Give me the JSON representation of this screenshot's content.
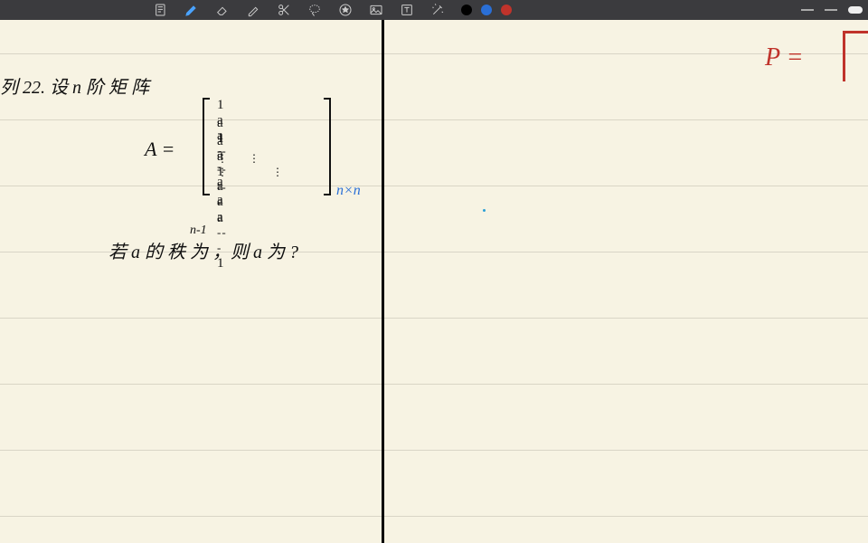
{
  "toolbar": {
    "icons": [
      {
        "name": "page-icon"
      },
      {
        "name": "pen-icon",
        "active": true
      },
      {
        "name": "eraser-icon"
      },
      {
        "name": "highlighter-icon"
      },
      {
        "name": "cut-icon"
      },
      {
        "name": "lasso-icon"
      },
      {
        "name": "star-tool-icon"
      },
      {
        "name": "image-icon"
      },
      {
        "name": "text-tool-icon"
      },
      {
        "name": "wand-icon"
      }
    ],
    "colors": [
      {
        "name": "color-black",
        "hex": "#000000"
      },
      {
        "name": "color-blue",
        "hex": "#2a6fd6"
      },
      {
        "name": "color-red",
        "hex": "#c0332b"
      }
    ]
  },
  "notes": {
    "left": {
      "line1": "列 22.  设 n 阶 矩 阵",
      "A_eq": "A =",
      "matrix_rows": [
        "1  a  a  ---  a",
        "a  1  a  ---  a",
        "a  a  1  ---  a",
        "⋮   ⋮   ⋮        ⋮",
        "a  a  a  ---  1"
      ],
      "matrix_sub": "n×n",
      "exponent": "n-1",
      "line2": "若 a 的 秩 为    ，则 a 为 ?"
    },
    "right": {
      "P_eq": "P ="
    }
  }
}
